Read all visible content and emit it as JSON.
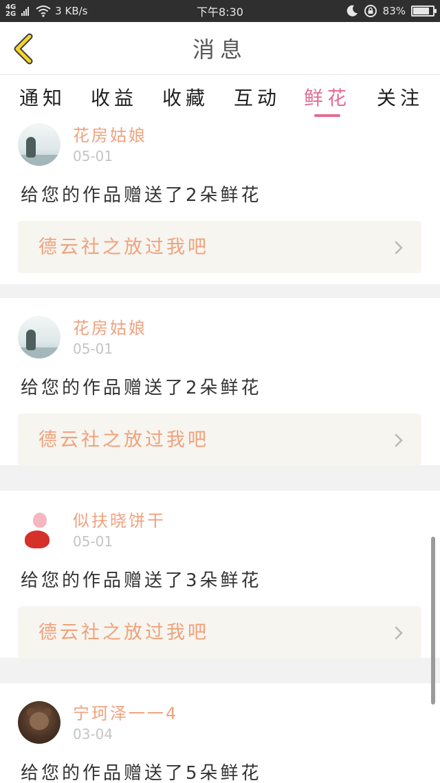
{
  "status_bar": {
    "network_top": "4G",
    "network_bottom": "2G",
    "speed": "3 KB/s",
    "time": "下午8:30",
    "battery": "83%",
    "battery_level": 0.83
  },
  "header": {
    "title": "消息"
  },
  "tabs": [
    {
      "label": "通知"
    },
    {
      "label": "收益"
    },
    {
      "label": "收藏"
    },
    {
      "label": "互动"
    },
    {
      "label": "鲜花"
    },
    {
      "label": "关注"
    }
  ],
  "active_tab": "鲜花",
  "notifications": [
    {
      "username": "花房姑娘",
      "date": "05-01",
      "message": "给您的作品赠送了2朵鲜花",
      "work_title": "德云社之放过我吧"
    },
    {
      "username": "花房姑娘",
      "date": "05-01",
      "message": "给您的作品赠送了2朵鲜花",
      "work_title": "德云社之放过我吧"
    },
    {
      "username": "似扶晓饼干",
      "date": "05-01",
      "message": "给您的作品赠送了3朵鲜花",
      "work_title": "德云社之放过我吧"
    },
    {
      "username": "宁珂泽一一4",
      "date": "03-04",
      "message": "给您的作品赠送了5朵鲜花"
    }
  ],
  "colors": {
    "accent": "#e36b95",
    "username": "#f0a27e",
    "link_text": "#f1a17a",
    "link_bg": "#f6f5f0",
    "back_arrow": "#f6d42b"
  }
}
